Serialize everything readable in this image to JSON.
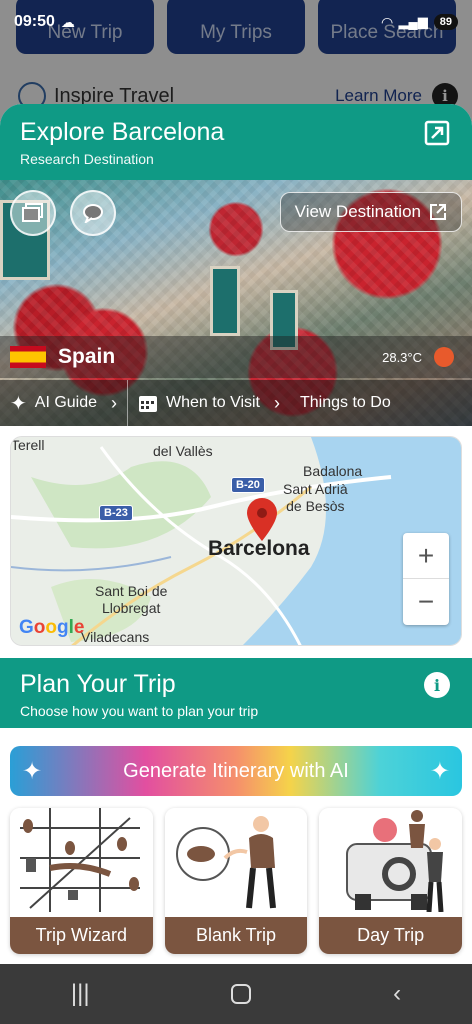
{
  "status_bar": {
    "time": "09:50",
    "battery": "89"
  },
  "background": {
    "tabs": [
      "New Trip",
      "My Trips",
      "Place Search"
    ],
    "inspire_title": "Inspire Travel",
    "learn_more": "Learn More"
  },
  "explore": {
    "title": "Explore Barcelona",
    "subtitle": "Research Destination",
    "view_destination": "View Destination",
    "country": "Spain",
    "temperature": "28.3°C",
    "guide_items": [
      "AI Guide",
      "When to Visit",
      "Things to Do"
    ]
  },
  "map": {
    "labels": {
      "vallès": "del Vallès",
      "badalona": "Badalona",
      "sant_adria": "Sant Adrià\nde Besòs",
      "barcelona": "Barcelona",
      "sant_boi": "Sant Boi de\nLlobregat",
      "viladecans": "Viladecans",
      "terell": "Terell"
    },
    "shields": [
      "B-20",
      "B-23"
    ],
    "google": "Google"
  },
  "plan": {
    "title": "Plan Your Trip",
    "subtitle": "Choose how you want to plan your trip",
    "generate_label": "Generate Itinerary with AI",
    "cards": [
      {
        "label": "Trip Wizard"
      },
      {
        "label": "Blank Trip"
      },
      {
        "label": "Day Trip"
      }
    ]
  },
  "colors": {
    "teal": "#0f9a85",
    "brown": "#7b5540",
    "navy": "#1f3f8c"
  },
  "icons": [
    "expand-icon",
    "gallery-icon",
    "chat-icon",
    "external-link-icon",
    "sparkle-icon",
    "calendar-icon",
    "chevron-right-icon",
    "info-icon",
    "map-pin-icon",
    "sun-icon",
    "flag-icon"
  ]
}
